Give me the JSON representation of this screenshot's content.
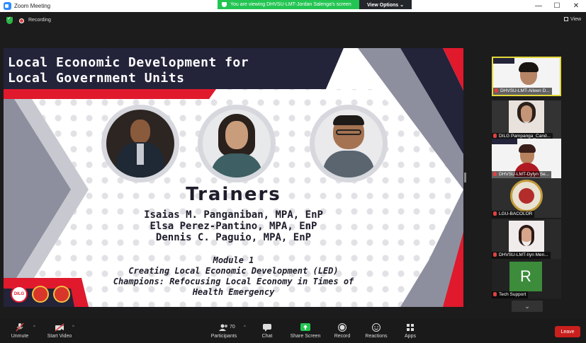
{
  "window": {
    "title": "Zoom Meeting"
  },
  "share_banner": {
    "text": "You are viewing DHVSU-LMT-Jordan Salenga's screen",
    "options_label": "View Options ⌄"
  },
  "status": {
    "recording_label": "Recording",
    "view_label": "View"
  },
  "slide": {
    "title_line1": "Local Economic Development for",
    "title_line2": "Local Government Units",
    "heading": "Trainers",
    "trainers": [
      "Isaias M. Panganiban, MPA, EnP",
      "Elsa Perez-Pantino, MPA, EnP",
      "Dennis C. Paguio, MPA, EnP"
    ],
    "module_lines": [
      "Module 1",
      "Creating Local Economic Development (LED)",
      "Champions: Refocusing Local Economy in Times of",
      "Health Emergency"
    ],
    "logo_text": "DILG"
  },
  "participants_tiles": [
    {
      "name": "DHVSU-LMT-Aileen D..."
    },
    {
      "name": "DILG Pampanga_Cand..."
    },
    {
      "name": "DHVSU-LMT-Dylyn Se..."
    },
    {
      "name": "LGU-BACOLOR"
    },
    {
      "name": "DHVSU-LMT-Ilyn Men..."
    },
    {
      "name": "Tech Support",
      "initial": "R"
    }
  ],
  "toolbar": {
    "unmute": "Unmute",
    "start_video": "Start Video",
    "participants": "Participants",
    "participants_count": "70",
    "chat": "Chat",
    "share_screen": "Share Screen",
    "record": "Record",
    "reactions": "Reactions",
    "apps": "Apps",
    "leave": "Leave"
  },
  "more_chevron": "⌄",
  "colors": {
    "accent_red": "#e0192d",
    "navy": "#23233a",
    "zoom_green": "#23c552",
    "leave_red": "#c9201e",
    "active_tile_border": "#e4d93a"
  }
}
